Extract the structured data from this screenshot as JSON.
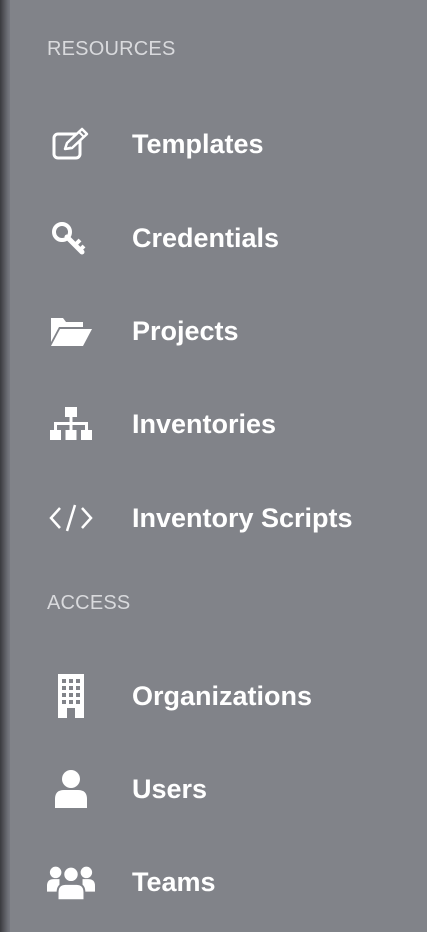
{
  "sidebar": {
    "resources_header": "RESOURCES",
    "access_header": "ACCESS",
    "resources": [
      {
        "label": "Templates",
        "icon": "edit-icon"
      },
      {
        "label": "Credentials",
        "icon": "key-icon"
      },
      {
        "label": "Projects",
        "icon": "folder-open-icon"
      },
      {
        "label": "Inventories",
        "icon": "sitemap-icon"
      },
      {
        "label": "Inventory Scripts",
        "icon": "code-icon"
      }
    ],
    "access": [
      {
        "label": "Organizations",
        "icon": "building-icon"
      },
      {
        "label": "Users",
        "icon": "user-icon"
      },
      {
        "label": "Teams",
        "icon": "users-icon"
      }
    ]
  },
  "colors": {
    "sidebar_bg": "#818389",
    "header_text": "#d9dadd",
    "item_text": "#ffffff"
  }
}
